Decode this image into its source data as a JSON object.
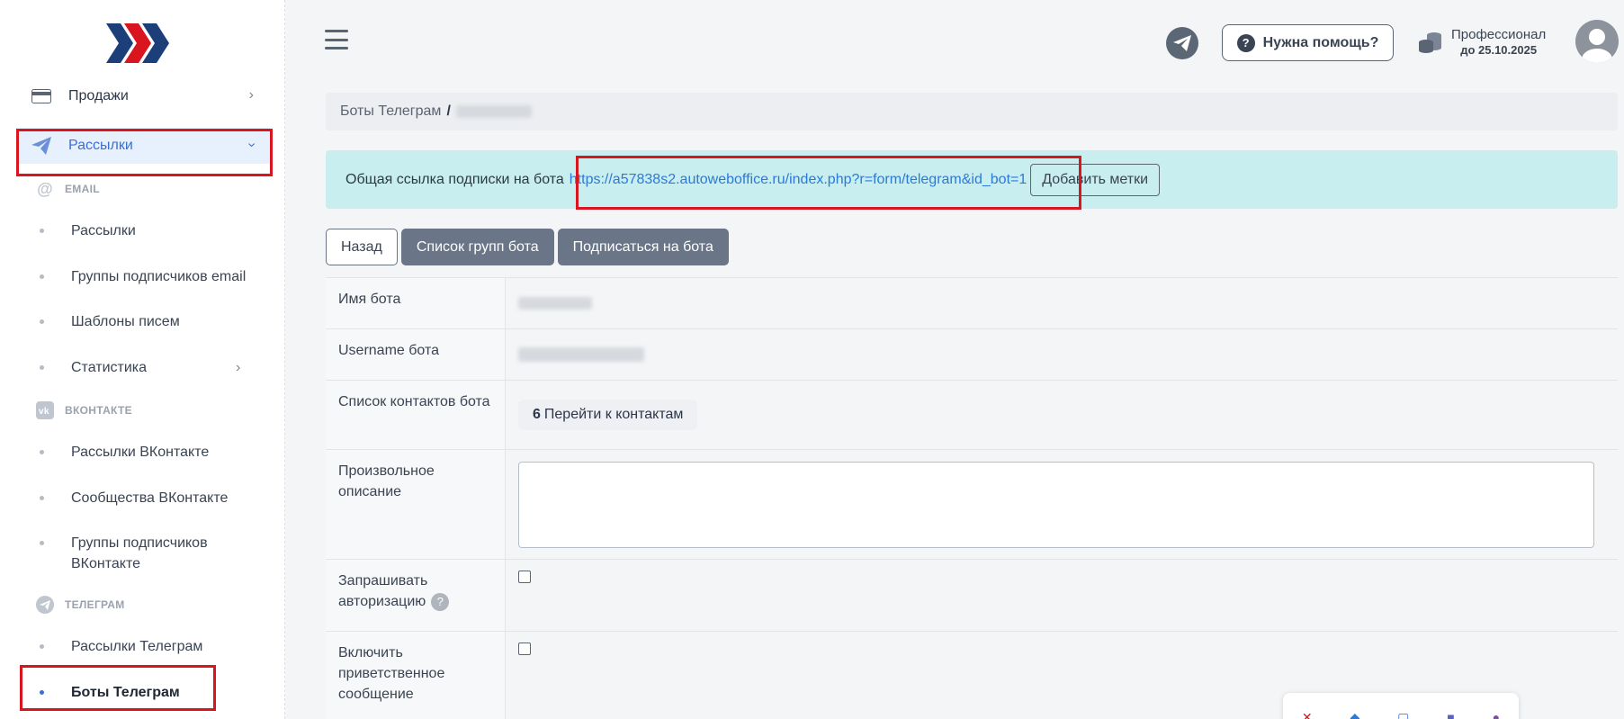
{
  "sidebar": {
    "items": [
      {
        "label": "Продажи",
        "icon": "card-icon"
      },
      {
        "label": "Рассылки",
        "icon": "paper-plane-icon"
      }
    ],
    "sections": {
      "email": "EMAIL",
      "vk": "ВКОНТАКТЕ",
      "telegram": "ТЕЛЕГРАМ"
    },
    "email_items": [
      "Рассылки",
      "Группы подписчиков email",
      "Шаблоны писем",
      "Статистика"
    ],
    "vk_items": [
      "Рассылки ВКонтакте",
      "Сообщества ВКонтакте",
      "Группы подписчиков ВКонтакте"
    ],
    "telegram_items": [
      "Рассылки Телеграм",
      "Боты Телеграм"
    ]
  },
  "header": {
    "help_label": "Нужна помощь?",
    "plan_name": "Профессионал",
    "plan_until": "до 25.10.2025"
  },
  "breadcrumb": {
    "parent": "Боты Телеграм",
    "separator": "/"
  },
  "alert": {
    "text": "Общая ссылка подписки на бота",
    "link": "https://a57838s2.autoweboffice.ru/index.php?r=form/telegram&id_bot=1",
    "add_tags_label": "Добавить метки"
  },
  "buttons": {
    "back": "Назад",
    "groups": "Список групп бота",
    "subscribe": "Подписаться на бота"
  },
  "details": {
    "bot_name_label": "Имя бота",
    "username_label": "Username бота",
    "contacts_label": "Список контактов бота",
    "contacts_count": "6",
    "contacts_link": "Перейти к контактам",
    "description_label": "Произвольное описание",
    "auth_label": "Запрашивать авторизацию",
    "welcome_label": "Включить приветственное сообщение"
  },
  "colors": {
    "accent": "#3b6fd6",
    "highlight": "#d9151f",
    "alert_bg": "#c8eef0"
  }
}
